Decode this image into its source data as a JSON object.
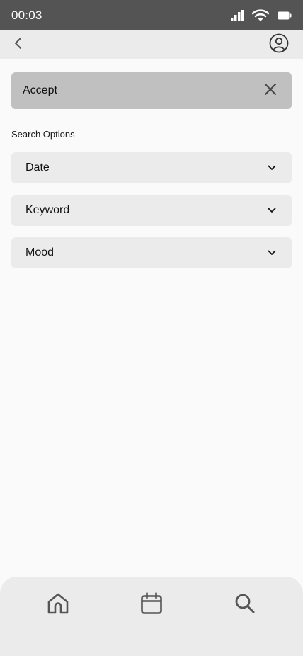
{
  "status_bar": {
    "time": "00:03",
    "icons": [
      "signal-icon",
      "wifi-icon",
      "battery-icon"
    ]
  },
  "nav": {
    "back_icon": "chevron-left-icon",
    "profile_icon": "user-circle-icon"
  },
  "accept_bar": {
    "label": "Accept",
    "close_icon": "close-icon"
  },
  "search_options": {
    "title": "Search Options",
    "dropdowns": [
      {
        "label": "Date",
        "icon": "chevron-down-icon"
      },
      {
        "label": "Keyword",
        "icon": "chevron-down-icon"
      },
      {
        "label": "Mood",
        "icon": "chevron-down-icon"
      }
    ]
  },
  "tab_bar": {
    "tabs": [
      {
        "name": "home",
        "icon": "home-icon"
      },
      {
        "name": "calendar",
        "icon": "calendar-icon"
      },
      {
        "name": "search",
        "icon": "search-icon"
      }
    ]
  },
  "colors": {
    "status_bar_bg": "#545454",
    "nav_bg": "#ebebeb",
    "page_bg": "#fafafa",
    "accept_bg": "#c0c0c0",
    "dropdown_bg": "#ebebeb",
    "icon_color": "#555555"
  }
}
